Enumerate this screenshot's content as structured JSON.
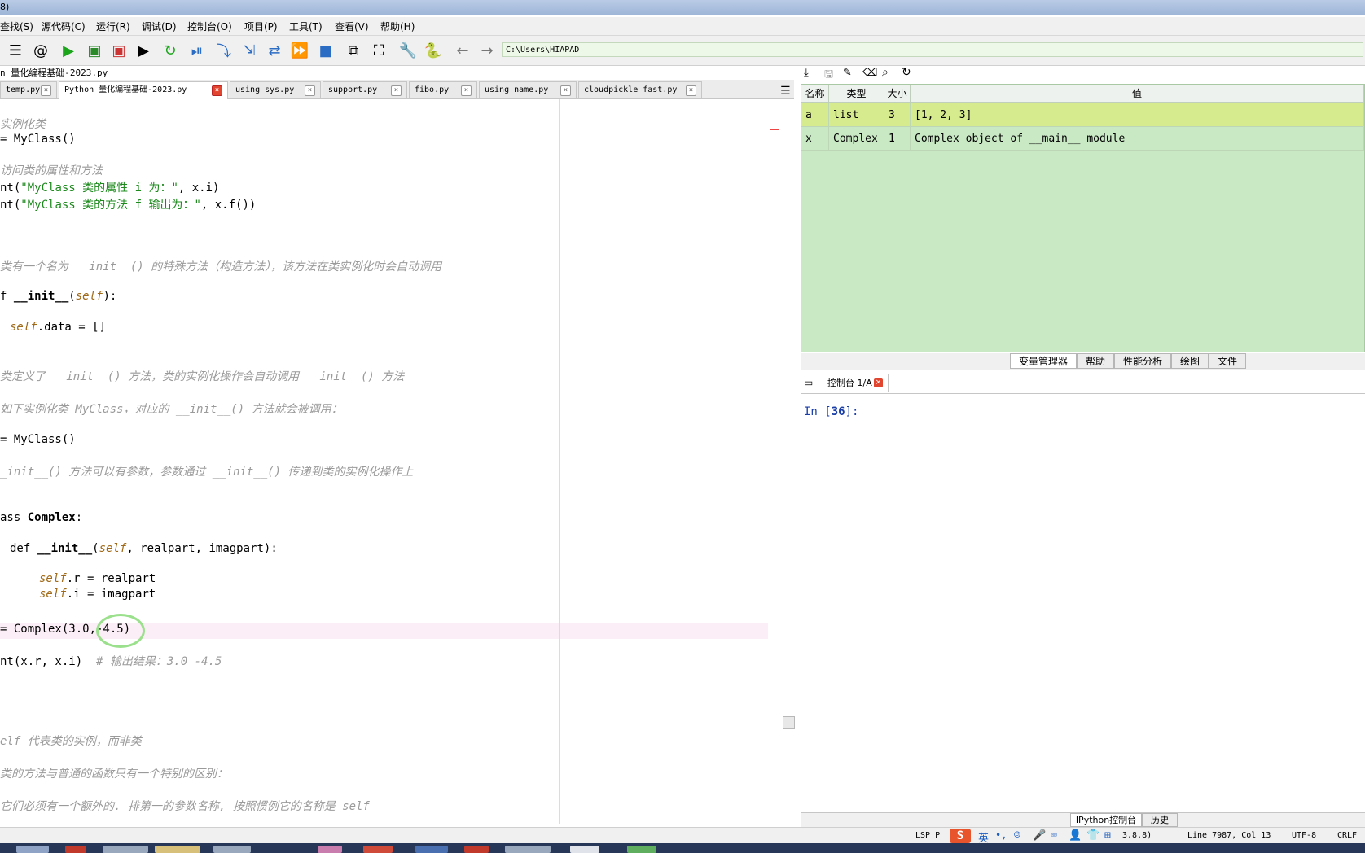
{
  "window": {
    "title_fragment": "8)"
  },
  "menu": [
    "查找(S)",
    "源代码(C)",
    "运行(R)",
    "调试(D)",
    "控制台(O)",
    "项目(P)",
    "工具(T)",
    "查看(V)",
    "帮助(H)"
  ],
  "toolbar": {
    "path": "C:\\Users\\HIAPAD"
  },
  "file_title": "n 量化编程基础-2023.py",
  "tabs": [
    {
      "label": "temp.py",
      "active": false
    },
    {
      "label": "Python 量化编程基础-2023.py",
      "active": true
    },
    {
      "label": "using_sys.py",
      "active": false
    },
    {
      "label": "support.py",
      "active": false
    },
    {
      "label": "fibo.py",
      "active": false
    },
    {
      "label": "using_name.py",
      "active": false
    },
    {
      "label": "cloudpickle_fast.py",
      "active": false
    }
  ],
  "code": {
    "l1": "实例化类",
    "l2a": "= MyClass()",
    "l3": "访问类的属性和方法",
    "l4a": "nt(",
    "l4b": "\"MyClass 类的属性 i 为：\"",
    "l4c": ", x.i)",
    "l5a": "nt(",
    "l5b": "\"MyClass 类的方法 f 输出为：\"",
    "l5c": ", x.f())",
    "l6": "类有一个名为 __init__() 的特殊方法（构造方法），该方法在类实例化时会自动调用",
    "l7a": "f ",
    "l7b": "__init__",
    "l7c": "(",
    "l7d": "self",
    "l7e": "):",
    "l8a": "self",
    "l8b": ".data = []",
    "l9": "类定义了 __init__() 方法，类的实例化操作会自动调用 __init__() 方法",
    "l10": "如下实例化类 MyClass，对应的 __init__() 方法就会被调用：",
    "l11": "= MyClass()",
    "l12": "_init__() 方法可以有参数，参数通过 __init__() 传递到类的实例化操作上",
    "l13a": "ass ",
    "l13b": "Complex",
    "l13c": ":",
    "l14a": "def ",
    "l14b": "__init__",
    "l14c": "(",
    "l14d": "self",
    "l14e": ", realpart, imagpart):",
    "l15a": "self",
    "l15b": ".r = realpart",
    "l16a": "self",
    "l16b": ".i = imagpart",
    "l17": "= Complex(3.0,-4.5)",
    "l18a": "nt(x.r, x.i)",
    "l18b": "  # 输出结果：3.0 -4.5",
    "l19": "elf 代表类的实例，而非类",
    "l20": "类的方法与普通的函数只有一个特别的区别：",
    "l21": "它们必须有一个额外的. 排第一的参数名称, 按照惯例它的名称是 self"
  },
  "variables": {
    "headers": [
      "名称",
      "类型",
      "大小",
      "值"
    ],
    "rows": [
      {
        "name": "a",
        "type": "list",
        "size": "3",
        "value": "[1, 2, 3]"
      },
      {
        "name": "x",
        "type": "Complex",
        "size": "1",
        "value": "Complex object of __main__ module"
      }
    ]
  },
  "right_tabs": [
    "变量管理器",
    "帮助",
    "性能分析",
    "绘图",
    "文件"
  ],
  "console": {
    "tab_label": "控制台 1/A",
    "prompt_in": "In [",
    "prompt_num": "36",
    "prompt_end": "]:"
  },
  "bottom_tabs": [
    "IPython控制台",
    "历史"
  ],
  "status": {
    "lsp": "LSP P",
    "lang": "英",
    "python": "3.8.8)",
    "position": "Line 7987, Col 13",
    "encoding": "UTF-8",
    "eol": "CRLF"
  },
  "colors": {
    "var_row_a": "#d6ea8e",
    "var_bg": "#c9e8c4",
    "run_green": "#1aa51a",
    "stop_blue": "#2b6cc4"
  }
}
